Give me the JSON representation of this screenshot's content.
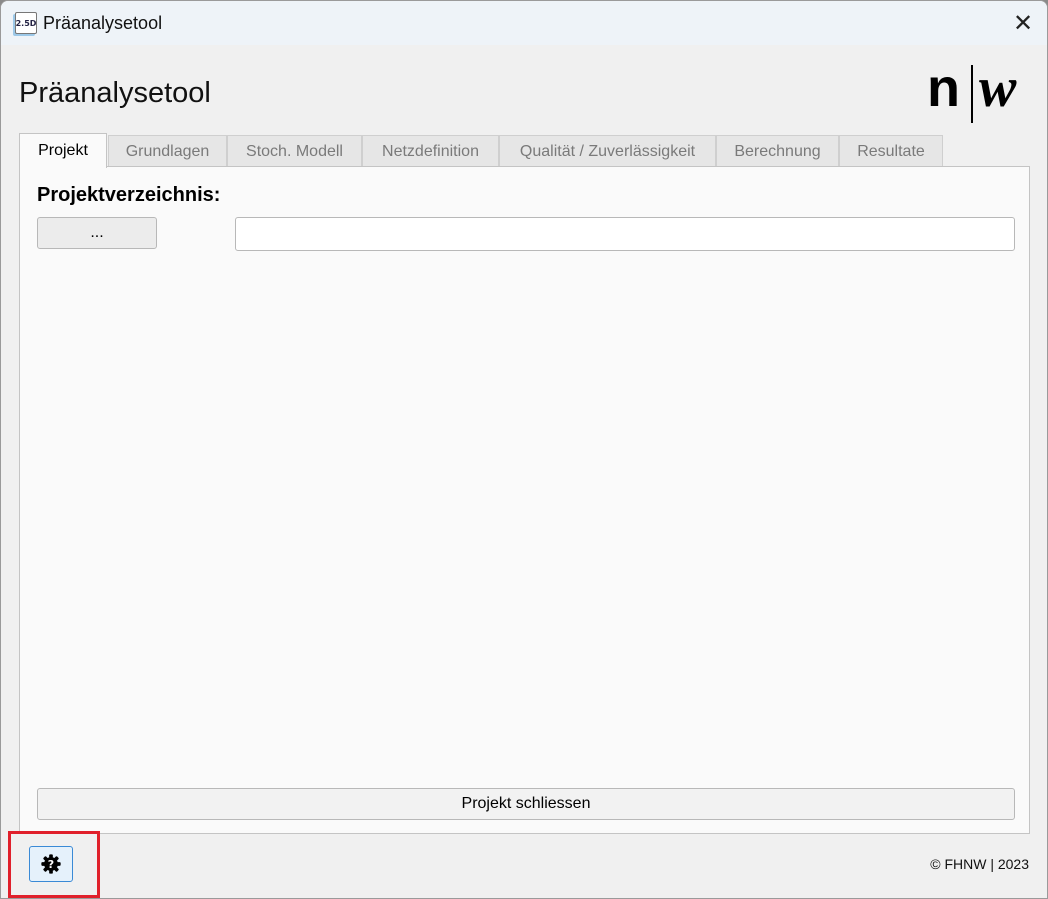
{
  "window": {
    "title": "Präanalysetool",
    "app_icon_text": "2.5D",
    "close_glyph": "✕"
  },
  "header": {
    "heading": "Präanalysetool",
    "logo": {
      "left": "n",
      "right": "w"
    }
  },
  "tabs": [
    {
      "label": "Projekt",
      "active": true
    },
    {
      "label": "Grundlagen",
      "active": false
    },
    {
      "label": "Stoch. Modell",
      "active": false
    },
    {
      "label": "Netzdefinition",
      "active": false
    },
    {
      "label": "Qualität / Zuverlässigkeit",
      "active": false
    },
    {
      "label": "Berechnung",
      "active": false
    },
    {
      "label": "Resultate",
      "active": false
    }
  ],
  "project": {
    "section_label": "Projektverzeichnis:",
    "browse_label": "...",
    "path_value": "",
    "close_label": "Projekt schliessen"
  },
  "footer": {
    "help_icon": "gear-question-icon",
    "copyright": "© FHNW | 2023",
    "highlight_color": "#e0202b"
  }
}
